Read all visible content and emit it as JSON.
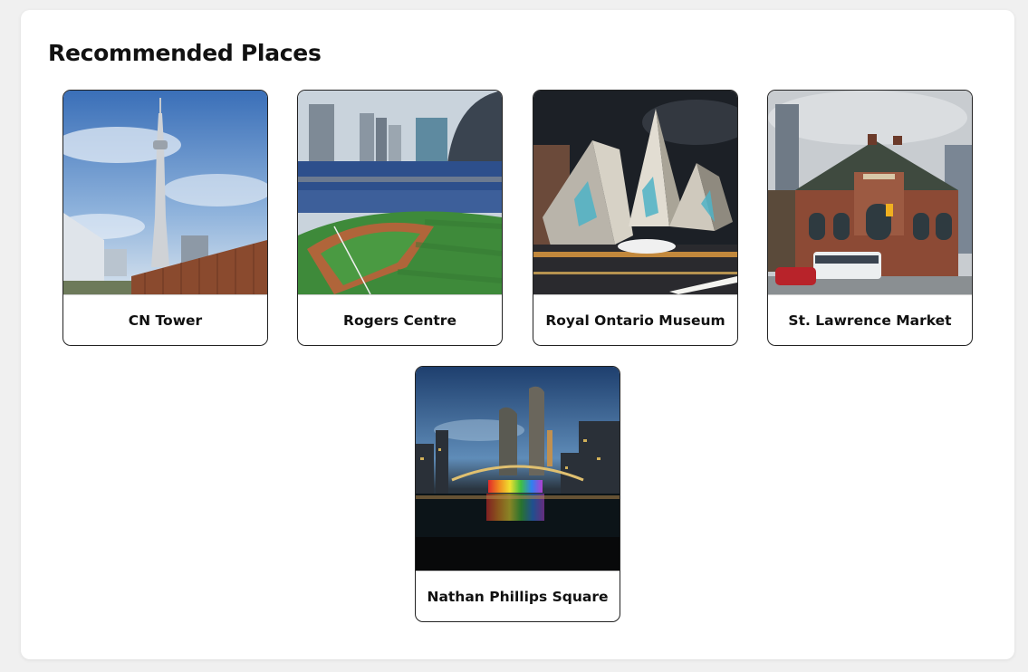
{
  "section": {
    "title": "Recommended Places"
  },
  "places": [
    {
      "name": "CN Tower",
      "image": "cn-tower-photo"
    },
    {
      "name": "Rogers Centre",
      "image": "rogers-centre-photo"
    },
    {
      "name": "Royal Ontario Museum",
      "image": "royal-ontario-museum-photo"
    },
    {
      "name": "St. Lawrence Market",
      "image": "st-lawrence-market-photo"
    },
    {
      "name": "Nathan Phillips Square",
      "image": "nathan-phillips-square-photo"
    }
  ]
}
